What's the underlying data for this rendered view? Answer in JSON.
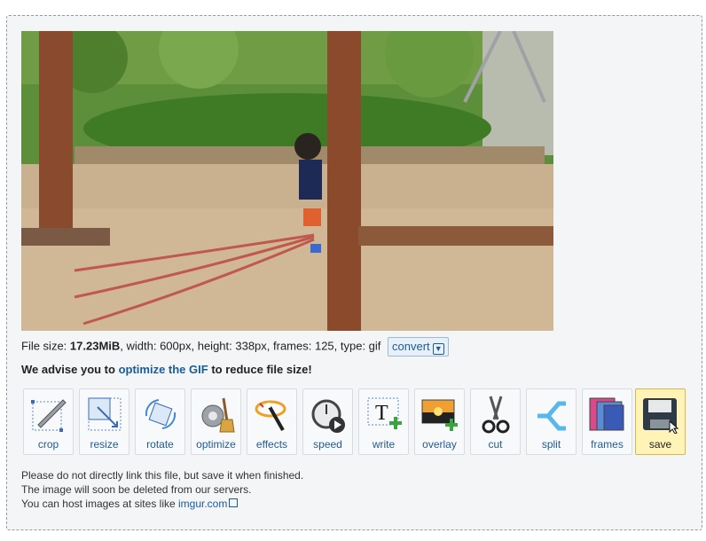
{
  "file_info": {
    "size_label": "File size: ",
    "size_value": "17.23MiB",
    "rest": ", width: 600px, height: 338px, frames: 125, type: gif",
    "convert_label": "convert"
  },
  "advise": {
    "prefix": "We advise you to ",
    "link": "optimize the GIF",
    "suffix": " to reduce file size!"
  },
  "tools": [
    {
      "label": "crop",
      "icon": "crop-icon"
    },
    {
      "label": "resize",
      "icon": "resize-icon"
    },
    {
      "label": "rotate",
      "icon": "rotate-icon"
    },
    {
      "label": "optimize",
      "icon": "optimize-icon"
    },
    {
      "label": "effects",
      "icon": "effects-icon"
    },
    {
      "label": "speed",
      "icon": "speed-icon"
    },
    {
      "label": "write",
      "icon": "write-icon"
    },
    {
      "label": "overlay",
      "icon": "overlay-icon"
    },
    {
      "label": "cut",
      "icon": "cut-icon"
    },
    {
      "label": "split",
      "icon": "split-icon"
    },
    {
      "label": "frames",
      "icon": "frames-icon"
    },
    {
      "label": "save",
      "icon": "save-icon"
    }
  ],
  "notes": {
    "line1": "Please do not directly link this file, but save it when finished.",
    "line2": "The image will soon be deleted from our servers.",
    "line3_prefix": "You can host images at sites like ",
    "line3_link": "imgur.com"
  },
  "colors": {
    "accent": "#1f5b94",
    "active_tool": "#fff3b8",
    "panel": "#f4f5f7"
  }
}
